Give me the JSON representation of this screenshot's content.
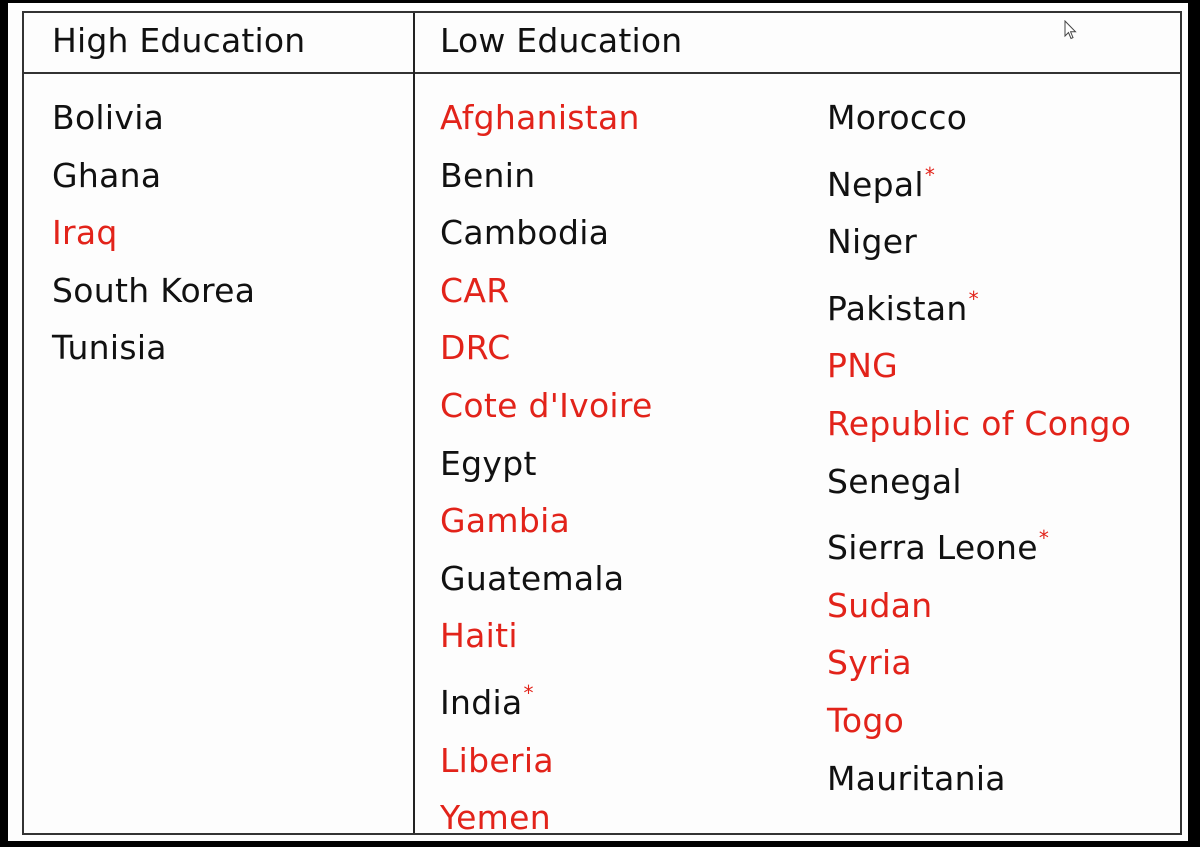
{
  "colors": {
    "red": "#e2231a",
    "black": "#111111"
  },
  "headers": {
    "high": "High Education",
    "low": "Low Education"
  },
  "high_education": [
    {
      "name": "Bolivia",
      "red": false,
      "star": false
    },
    {
      "name": "Ghana",
      "red": false,
      "star": false
    },
    {
      "name": "Iraq",
      "red": true,
      "star": false
    },
    {
      "name": "South Korea",
      "red": false,
      "star": false
    },
    {
      "name": "Tunisia",
      "red": false,
      "star": false
    }
  ],
  "low_education_col1": [
    {
      "name": "Afghanistan",
      "red": true,
      "star": false
    },
    {
      "name": "Benin",
      "red": false,
      "star": false
    },
    {
      "name": "Cambodia",
      "red": false,
      "star": false
    },
    {
      "name": "CAR",
      "red": true,
      "star": false
    },
    {
      "name": "DRC",
      "red": true,
      "star": false
    },
    {
      "name": "Cote d'Ivoire",
      "red": true,
      "star": false
    },
    {
      "name": "Egypt",
      "red": false,
      "star": false
    },
    {
      "name": "Gambia",
      "red": true,
      "star": false
    },
    {
      "name": "Guatemala",
      "red": false,
      "star": false
    },
    {
      "name": "Haiti",
      "red": true,
      "star": false
    },
    {
      "name": "India",
      "red": false,
      "star": true
    },
    {
      "name": "Liberia",
      "red": true,
      "star": false
    },
    {
      "name": "Yemen",
      "red": true,
      "star": false
    }
  ],
  "low_education_col2": [
    {
      "name": "Morocco",
      "red": false,
      "star": false
    },
    {
      "name": "Nepal",
      "red": false,
      "star": true
    },
    {
      "name": "Niger",
      "red": false,
      "star": false
    },
    {
      "name": "Pakistan",
      "red": false,
      "star": true
    },
    {
      "name": "PNG",
      "red": true,
      "star": false
    },
    {
      "name": "Republic of Congo",
      "red": true,
      "star": false
    },
    {
      "name": "Senegal",
      "red": false,
      "star": false
    },
    {
      "name": "Sierra Leone",
      "red": false,
      "star": true
    },
    {
      "name": "Sudan",
      "red": true,
      "star": false
    },
    {
      "name": "Syria",
      "red": true,
      "star": false
    },
    {
      "name": "Togo",
      "red": true,
      "star": false
    },
    {
      "name": "Mauritania",
      "red": false,
      "star": false
    }
  ],
  "star_symbol": "*",
  "cursor_icon": "mouse-pointer-icon"
}
